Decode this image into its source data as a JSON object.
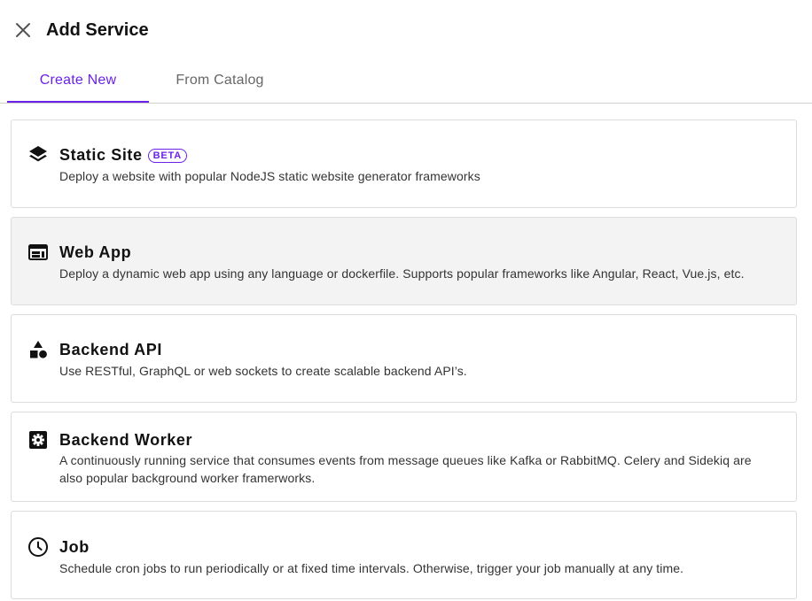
{
  "header": {
    "title": "Add Service",
    "close_icon": "close-icon"
  },
  "tabs": [
    {
      "label": "Create New",
      "active": true
    },
    {
      "label": "From Catalog",
      "active": false
    }
  ],
  "colors": {
    "accent": "#6b21e8",
    "card_border": "#dcdcdc",
    "card_hover_bg": "#f3f3f3"
  },
  "services": [
    {
      "icon": "layers-icon",
      "title": "Static Site",
      "badge": "BETA",
      "description": "Deploy a website with popular NodeJS static website generator frameworks"
    },
    {
      "icon": "web-window-icon",
      "title": "Web App",
      "description": "Deploy a dynamic web app using any language or dockerfile. Supports popular frameworks like Angular, React, Vue.js, etc."
    },
    {
      "icon": "shapes-icon",
      "title": "Backend API",
      "description": "Use RESTful, GraphQL or web sockets to create scalable backend API’s."
    },
    {
      "icon": "gear-icon",
      "title": "Backend Worker",
      "description": "A continuously running service that consumes events from message queues like Kafka or RabbitMQ. Celery and Sidekiq are also popular background worker framerworks."
    },
    {
      "icon": "clock-icon",
      "title": "Job",
      "description": "Schedule cron jobs to run periodically or at fixed time intervals. Otherwise, trigger your job manually at any time."
    }
  ]
}
